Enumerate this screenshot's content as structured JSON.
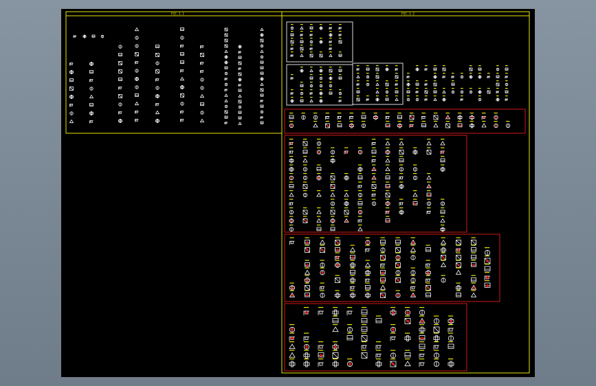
{
  "window": {
    "title": "",
    "background": "#7a8794"
  },
  "sheet": {
    "background": "#000000",
    "left_panel": {
      "title": "PIC.1-1",
      "border_color": "#e8e800"
    },
    "right_panel": {
      "title": "PIC.1-2",
      "border_color": "#e8e800"
    },
    "group_border_color": "#d01818",
    "symbol_color": "#ffffff",
    "label_color": "#e8e800",
    "highlight_color": "#d01818"
  },
  "icons": [
    "pipe-fitting-symbol",
    "valve-symbol",
    "flange-symbol",
    "elbow-symbol",
    "tee-symbol"
  ]
}
